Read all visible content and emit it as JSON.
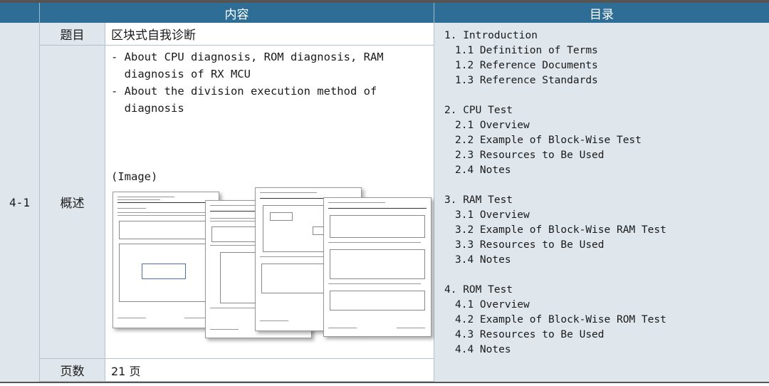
{
  "header": {
    "content": "内容",
    "toc": "目录"
  },
  "row": {
    "id": "4-1",
    "title_label": "题目",
    "title_value": "区块式自我诊断",
    "summary_label": "概述",
    "summary_lines": [
      "- About CPU diagnosis, ROM diagnosis, RAM",
      "  diagnosis of RX MCU",
      "- About the division execution method of",
      "  diagnosis"
    ],
    "image_label": "(Image)",
    "pages_label": "页数",
    "pages_value": "21 页"
  },
  "toc": {
    "s1": "1. Introduction",
    "s1_1": "1.1  Definition of Terms",
    "s1_2": "1.2  Reference Documents",
    "s1_3": "1.3  Reference Standards",
    "s2": "2. CPU Test",
    "s2_1": "2.1  Overview",
    "s2_2": "2.2  Example of Block-Wise Test",
    "s2_3": "2.3  Resources to Be Used",
    "s2_4": "2.4  Notes",
    "s3": "3. RAM Test",
    "s3_1": "3.1  Overview",
    "s3_2": "3.2  Example of Block-Wise RAM Test",
    "s3_3": "3.3  Resources to Be Used",
    "s3_4": "3.4  Notes",
    "s4": "4. ROM Test",
    "s4_1": "4.1  Overview",
    "s4_2": "4.2  Example of Block-Wise ROM Test",
    "s4_3": "4.3  Resources to Be Used",
    "s4_4": "4.4  Notes"
  },
  "colors": {
    "header_bg": "#2e6e96",
    "label_bg": "#dfe6ec"
  }
}
